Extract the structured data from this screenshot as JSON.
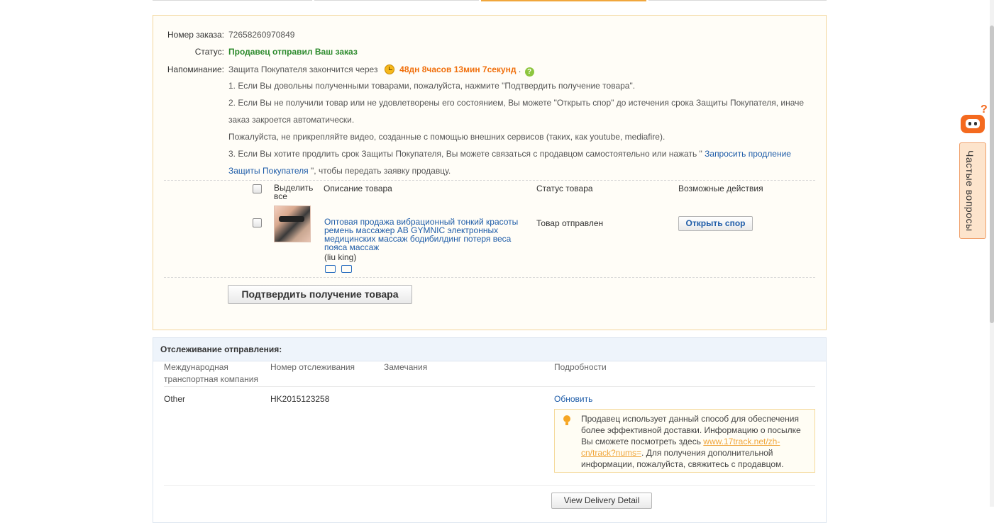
{
  "order": {
    "number_label": "Номер заказа:",
    "number_value": "72658260970849",
    "status_label": "Статус:",
    "status_value": "Продавец отправил Ваш заказ",
    "reminder_label": "Напоминание:",
    "reminder_text": "Защита Покупателя закончится через",
    "timer": "48дн 8часов 13мин 7секунд",
    "timer_suffix": ".",
    "help_glyph": "?",
    "note1": "1. Если Вы довольны полученными товарами, пожалуйста, нажмите \"Подтвердить получение товара\".",
    "note2a": "2. Если Вы не получили товар или не удовлетворены его состоянием, Вы можете \"Открыть спор\" до истечения срока Защиты Покупателя, иначе",
    "note2b": "заказ закроется автоматически.",
    "note3": "Пожалуйста, не прикрепляйте видео, созданные с помощью внешних сервисов (таких, как youtube, mediafire).",
    "note4_text": "3. Если Вы хотите продлить срок Защиты Покупателя, Вы можете связаться с продавцом самостоятельно или нажать \" ",
    "note4_link_part1": "Запросить продление",
    "note4_link_part2": "Защиты Покупателя",
    "note4_suffix": " \", чтобы передать заявку продавцу."
  },
  "items_table": {
    "select_all_label": "Выделить все",
    "col_description": "Описание товара",
    "col_status": "Статус товара",
    "col_actions": "Возможные действия",
    "rows": [
      {
        "title": "Оптовая продажа вибрационный тонкий красоты ремень массажер AB GYMNIC электронных медицинских массаж бодибилдинг потеря веса пояса массаж",
        "seller": "(liu king)",
        "status": "Товар отправлен",
        "action_label": "Открыть спор"
      }
    ]
  },
  "confirm_button": "Подтвердить получение товара",
  "tracking": {
    "title": "Отслеживание отправления:",
    "col_company": "Международная транспортная компания",
    "col_number": "Номер отслеживания",
    "col_remarks": "Замечания",
    "col_details": "Подробности",
    "row": {
      "company": "Other",
      "number": "HK2015123258",
      "remarks": "",
      "update_link": "Обновить"
    },
    "info_text_before": "Продавец использует данный способ для обеспечения более эффективной доставки. Информацию о посылке Вы сможете посмотреть здесь ",
    "info_link": "www.17track.net/zh-cn/track?nums=",
    "info_text_after": ". Для получения дополнительной информации, пожалуйста, свяжитесь с продавцом.",
    "delivery_button": "View Delivery Detail"
  },
  "faq": {
    "label": "Частые вопросы",
    "badge": "?"
  },
  "colors": {
    "accent_orange": "#f06f0c",
    "status_green": "#2e8b2e",
    "link_blue": "#1e5ca8",
    "box_border": "#f3d69c"
  }
}
